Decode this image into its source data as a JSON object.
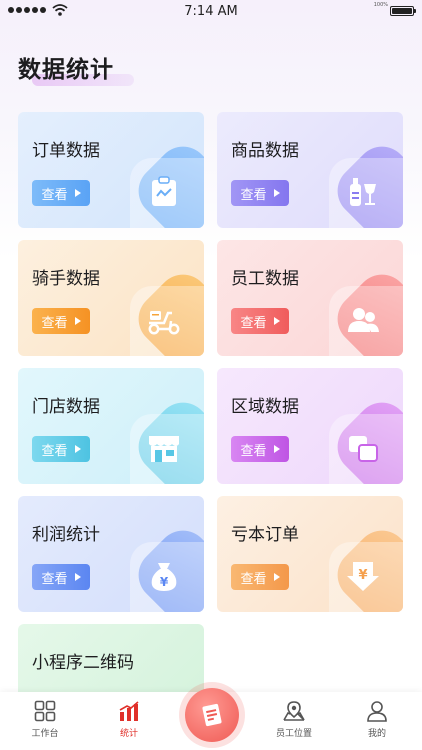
{
  "status_bar": {
    "time": "7:14 AM",
    "battery_pct": "100%"
  },
  "page": {
    "title": "数据统计"
  },
  "cards": [
    {
      "title": "订单数据",
      "button": "查看",
      "icon": "clipboard-chart-icon",
      "accent": "#5aa7f6"
    },
    {
      "title": "商品数据",
      "button": "查看",
      "icon": "bottle-glass-icon",
      "accent": "#8b7cf0"
    },
    {
      "title": "骑手数据",
      "button": "查看",
      "icon": "scooter-icon",
      "accent": "#f7a433"
    },
    {
      "title": "员工数据",
      "button": "查看",
      "icon": "people-icon",
      "accent": "#f46d6d"
    },
    {
      "title": "门店数据",
      "button": "查看",
      "icon": "storefront-icon",
      "accent": "#54c9e6"
    },
    {
      "title": "区域数据",
      "button": "查看",
      "icon": "overlap-squares-icon",
      "accent": "#c96ae8"
    },
    {
      "title": "利润统计",
      "button": "查看",
      "icon": "money-bag-icon",
      "accent": "#5b8df4"
    },
    {
      "title": "亏本订单",
      "button": "查看",
      "icon": "yen-down-arrow-icon",
      "accent": "#f6a04a"
    },
    {
      "title": "小程序二维码",
      "button": "",
      "icon": "",
      "accent": "#6fd08c"
    }
  ],
  "tab_bar": {
    "items": [
      {
        "label": "工作台",
        "icon": "grid-icon",
        "active": false
      },
      {
        "label": "统计",
        "icon": "bar-chart-icon",
        "active": true
      },
      {
        "label": "员工位置",
        "icon": "map-pin-icon",
        "active": false
      },
      {
        "label": "我的",
        "icon": "user-icon",
        "active": false
      }
    ],
    "center_icon": "document-edit-icon"
  }
}
